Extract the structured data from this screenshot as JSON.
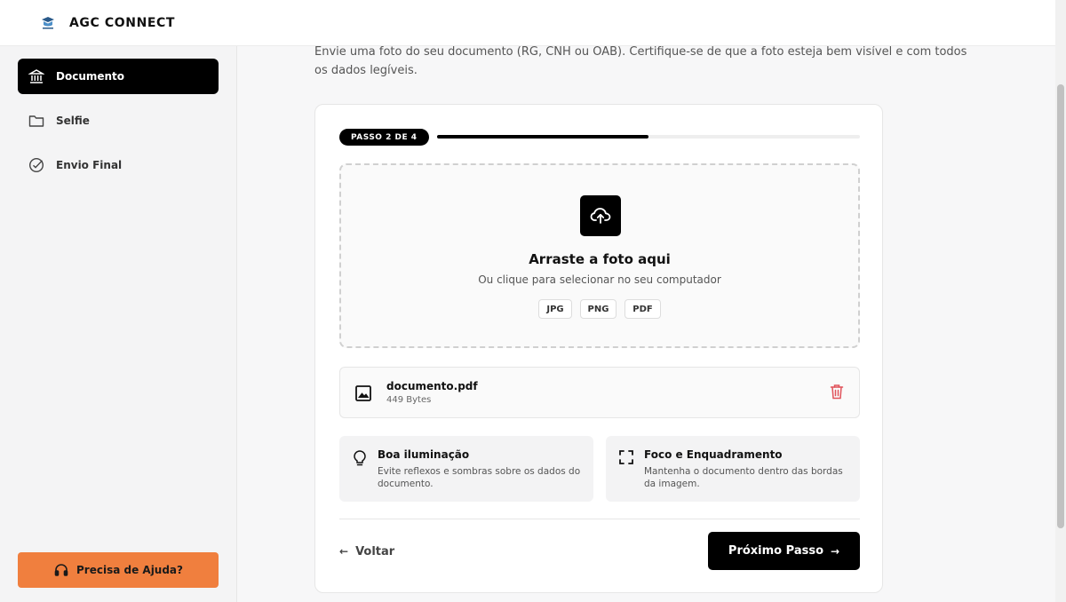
{
  "header": {
    "brand": "AGC CONNECT",
    "logo_icon": "shield-logo-icon"
  },
  "sidebar": {
    "items": [
      {
        "label": "Documento",
        "icon": "bank-icon",
        "active": true
      },
      {
        "label": "Selfie",
        "icon": "folder-icon",
        "active": false
      },
      {
        "label": "Envio Final",
        "icon": "check-circle-icon",
        "active": false
      }
    ],
    "help_label": "Precisa de Ajuda?",
    "help_icon": "headset-icon"
  },
  "intro": {
    "text": "Envie uma foto do seu documento (RG, CNH ou OAB). Certifique-se de que a foto esteja bem visível e com todos os dados legíveis."
  },
  "stepper": {
    "label": "PASSO 2 DE 4",
    "current": 2,
    "total": 4
  },
  "dropzone": {
    "title": "Arraste a foto aqui",
    "subtitle": "Ou clique para selecionar no seu computador",
    "formats": [
      "JPG",
      "PNG",
      "PDF"
    ],
    "icon": "cloud-upload-icon"
  },
  "file": {
    "name": "documento.pdf",
    "size": "449 Bytes",
    "icon": "image-icon",
    "remove_icon": "trash-icon"
  },
  "tips": [
    {
      "title": "Boa iluminação",
      "text": "Evite reflexos e sombras sobre os dados do documento.",
      "icon": "lightbulb-icon"
    },
    {
      "title": "Foco e Enquadramento",
      "text": "Mantenha o documento dentro das bordas da imagem.",
      "icon": "focus-frame-icon"
    }
  ],
  "actions": {
    "back_label": "Voltar",
    "next_label": "Próximo Passo"
  },
  "colors": {
    "accent": "#000000",
    "help": "#f07f3e",
    "danger": "#e0525a"
  }
}
